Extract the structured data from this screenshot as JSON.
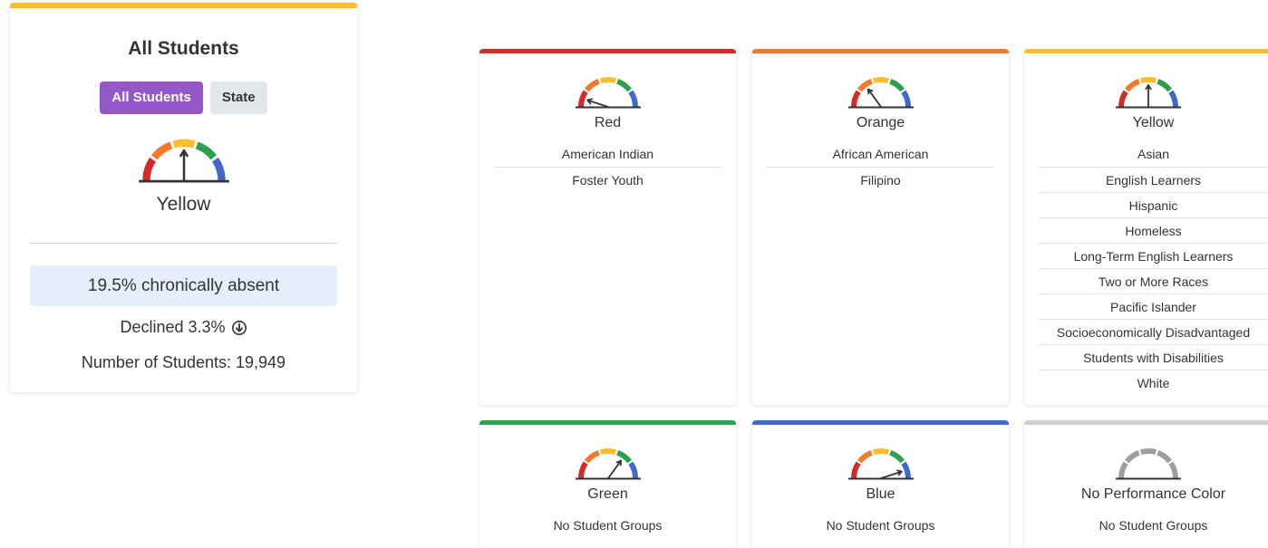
{
  "summary": {
    "title": "All Students",
    "toggle": {
      "active_label": "All Students",
      "inactive_label": "State"
    },
    "gauge_icon": "speedometer-gauge-icon",
    "performance_color": "Yellow",
    "chronic_absence_text": "19.5% chronically absent",
    "change_text": "Declined 3.3%",
    "change_icon": "arrow-down-circle-icon",
    "students_text": "Number of Students: 19,949",
    "accent": "#FBBF2E"
  },
  "gauge_colors": {
    "red": "#D42A2A",
    "orange": "#F47A2B",
    "yellow": "#FBBF2E",
    "green": "#2E9E4F",
    "blue": "#4268C8",
    "gray": "#9E9E9E"
  },
  "columns": [
    {
      "key": "red",
      "label": "Red",
      "accent": "#D42A2A",
      "needle_level": 1,
      "groups": [
        "American Indian",
        "Foster Youth"
      ],
      "empty_text": ""
    },
    {
      "key": "orange",
      "label": "Orange",
      "accent": "#F47A2B",
      "needle_level": 2,
      "groups": [
        "African American",
        "Filipino"
      ],
      "empty_text": ""
    },
    {
      "key": "yellow",
      "label": "Yellow",
      "accent": "#FBBF2E",
      "needle_level": 3,
      "groups": [
        "Asian",
        "English Learners",
        "Hispanic",
        "Homeless",
        "Long-Term English Learners",
        "Two or More Races",
        "Pacific Islander",
        "Socioeconomically Disadvantaged",
        "Students with Disabilities",
        "White"
      ],
      "empty_text": ""
    },
    {
      "key": "green",
      "label": "Green",
      "accent": "#2E9E4F",
      "needle_level": 4,
      "groups": [],
      "empty_text": "No Student Groups"
    },
    {
      "key": "blue",
      "label": "Blue",
      "accent": "#4268C8",
      "needle_level": 5,
      "groups": [],
      "empty_text": "No Student Groups"
    },
    {
      "key": "none",
      "label": "No Performance Color",
      "accent": "#D0D0D0",
      "needle_level": 0,
      "groups": [],
      "empty_text": "No Student Groups"
    }
  ]
}
